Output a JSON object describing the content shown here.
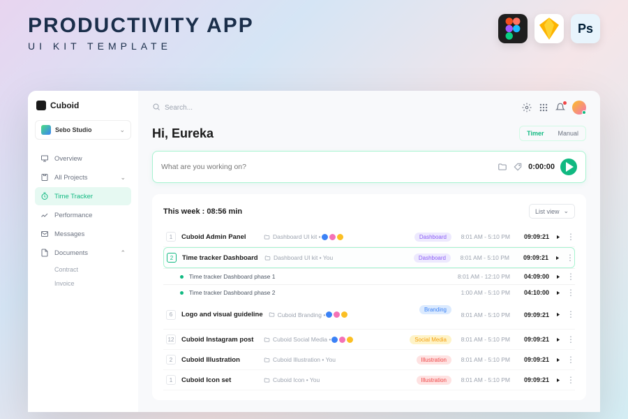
{
  "promo": {
    "title": "PRODUCTIVITY APP",
    "subtitle": "UI KIT TEMPLATE"
  },
  "apps": [
    "figma",
    "sketch",
    "photoshop"
  ],
  "brand": "Cuboid",
  "workspace": "Sebo Studio",
  "search_placeholder": "Search...",
  "nav": [
    {
      "label": "Overview"
    },
    {
      "label": "All Projects",
      "expandable": true
    },
    {
      "label": "Time Tracker",
      "active": true
    },
    {
      "label": "Performance"
    },
    {
      "label": "Messages"
    },
    {
      "label": "Documents",
      "expandable": true,
      "children": [
        "Contract",
        "Invoice"
      ]
    }
  ],
  "greeting": "Hi, Eureka",
  "modes": {
    "timer": "Timer",
    "manual": "Manual"
  },
  "task": {
    "placeholder": "What are you working on?",
    "time": "0:00:00"
  },
  "week_label": "This week : 08:56 min",
  "view_label": "List view",
  "rows": [
    {
      "num": "1",
      "title": "Cuboid Admin Panel",
      "folder": "Dashboard UI kit",
      "assignees": 3,
      "tag": "Dashboard",
      "tag_class": "dash",
      "range": "8:01 AM - 5:10 PM",
      "dur": "09:09:21"
    },
    {
      "num": "2",
      "title": "Time tracker Dashboard",
      "folder": "Dashboard UI kit",
      "you": "You",
      "tag": "Dashboard",
      "tag_class": "dash",
      "range": "8:01 AM - 5:10 PM",
      "dur": "09:09:21",
      "selected": true,
      "subtasks": [
        {
          "title": "Time tracker Dashboard phase 1",
          "range": "8:01 AM - 12:10 PM",
          "dur": "04:09:00"
        },
        {
          "title": "Time tracker Dashboard phase 2",
          "range": "1:00 AM - 5:10 PM",
          "dur": "04:10:00"
        }
      ]
    },
    {
      "num": "6",
      "title": "Logo and visual guideline",
      "folder": "Cuboid Branding",
      "assignees": 3,
      "tag": "Branding",
      "tag_class": "brand",
      "range": "8:01 AM - 5:10 PM",
      "dur": "09:09:21"
    },
    {
      "num": "12",
      "title": "Cuboid Instagram post",
      "folder": "Cuboid Social Media",
      "assignees": 3,
      "tag": "Social Media",
      "tag_class": "social",
      "range": "8:01 AM - 5:10 PM",
      "dur": "09:09:21"
    },
    {
      "num": "2",
      "title": "Cuboid Illustration",
      "folder": "Cuboid Illustration",
      "you": "You",
      "tag": "Illustration",
      "tag_class": "illus",
      "range": "8:01 AM - 5:10 PM",
      "dur": "09:09:21"
    },
    {
      "num": "1",
      "title": "Cuboid Icon set",
      "folder": "Cuboid Icon",
      "you": "You",
      "tag": "Illustration",
      "tag_class": "illus",
      "range": "8:01 AM - 5:10 PM",
      "dur": "09:09:21"
    }
  ]
}
